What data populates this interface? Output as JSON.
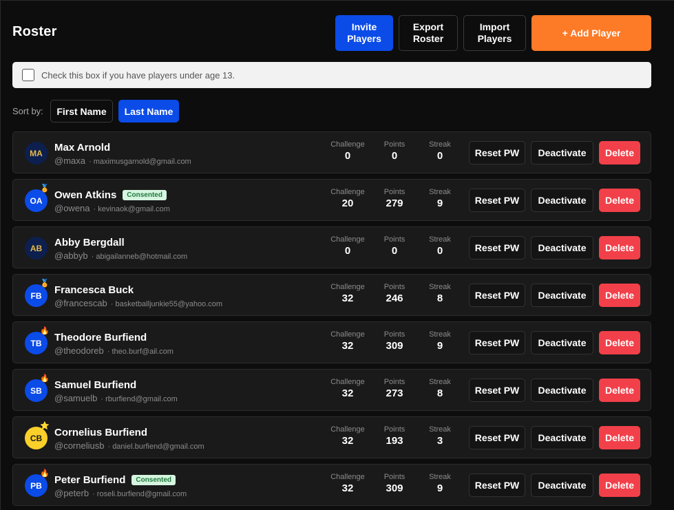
{
  "page": {
    "title": "Roster"
  },
  "header_buttons": {
    "invite": "Invite Players",
    "export": "Export Roster",
    "import": "Import Players",
    "add": "+ Add Player"
  },
  "consent": {
    "text": "Check this box if you have players under age 13.",
    "checked": false
  },
  "sort": {
    "label": "Sort by:",
    "options": [
      "First Name",
      "Last Name"
    ],
    "selected": "Last Name"
  },
  "stat_labels": {
    "challenge": "Challenge",
    "points": "Points",
    "streak": "Streak"
  },
  "row_actions": {
    "reset": "Reset PW",
    "deactivate": "Deactivate",
    "delete": "Delete"
  },
  "consented_label": "Consented",
  "colors": {
    "primary_blue": "#0b4be8",
    "accent_orange": "#fd7a26",
    "danger_red": "#f2404a",
    "consented_bg": "#d6f5e0",
    "consented_text": "#1f7a3d"
  },
  "players": [
    {
      "initials": "MA",
      "name": "Max Arnold",
      "handle": "@maxa",
      "email": "maximusgarnold@gmail.com",
      "consented": false,
      "badge": "",
      "avatar_style": "navy",
      "challenge": "0",
      "points": "0",
      "streak": "0"
    },
    {
      "initials": "OA",
      "name": "Owen Atkins",
      "handle": "@owena",
      "email": "kevinaok@gmail.com",
      "consented": true,
      "badge": "medal-icon",
      "avatar_style": "blue",
      "challenge": "20",
      "points": "279",
      "streak": "9"
    },
    {
      "initials": "AB",
      "name": "Abby Bergdall",
      "handle": "@abbyb",
      "email": "abigailanneb@hotmail.com",
      "consented": false,
      "badge": "",
      "avatar_style": "navy",
      "challenge": "0",
      "points": "0",
      "streak": "0"
    },
    {
      "initials": "FB",
      "name": "Francesca Buck",
      "handle": "@francescab",
      "email": "basketballjunkie55@yahoo.com",
      "consented": false,
      "badge": "medal-icon",
      "avatar_style": "blue",
      "challenge": "32",
      "points": "246",
      "streak": "8"
    },
    {
      "initials": "TB",
      "name": "Theodore Burfiend",
      "handle": "@theodoreb",
      "email": "theo.burf@ail.com",
      "consented": false,
      "badge": "flame-icon",
      "avatar_style": "blue",
      "challenge": "32",
      "points": "309",
      "streak": "9"
    },
    {
      "initials": "SB",
      "name": "Samuel Burfiend",
      "handle": "@samuelb",
      "email": "rburfiend@gmail.com",
      "consented": false,
      "badge": "flame-icon",
      "avatar_style": "blue",
      "challenge": "32",
      "points": "273",
      "streak": "8"
    },
    {
      "initials": "CB",
      "name": "Cornelius Burfiend",
      "handle": "@corneliusb",
      "email": "daniel.burfiend@gmail.com",
      "consented": false,
      "badge": "star-icon",
      "avatar_style": "yellow",
      "challenge": "32",
      "points": "193",
      "streak": "3"
    },
    {
      "initials": "PB",
      "name": "Peter Burfiend",
      "handle": "@peterb",
      "email": "roseli.burfiend@gmail.com",
      "consented": true,
      "badge": "flame-icon",
      "avatar_style": "blue",
      "challenge": "32",
      "points": "309",
      "streak": "9"
    }
  ]
}
